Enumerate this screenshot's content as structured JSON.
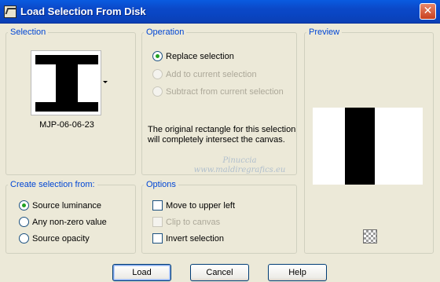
{
  "window": {
    "title": "Load Selection From Disk",
    "close_glyph": "✕",
    "app_icon": "selection-tool-icon"
  },
  "selection_group": {
    "title": "Selection",
    "selected_name": "MJP-06-06-23"
  },
  "operation_group": {
    "title": "Operation",
    "options": [
      {
        "label": "Replace selection",
        "checked": true,
        "enabled": true
      },
      {
        "label": "Add to current selection",
        "checked": false,
        "enabled": false
      },
      {
        "label": "Subtract from current selection",
        "checked": false,
        "enabled": false
      }
    ],
    "info_text": "The original rectangle for this selection will completely intersect the canvas."
  },
  "preview_group": {
    "title": "Preview",
    "background_icon": "checkerboard-icon"
  },
  "create_group": {
    "title": "Create selection from:",
    "options": [
      {
        "label": "Source luminance",
        "checked": true
      },
      {
        "label": "Any non-zero value",
        "checked": false
      },
      {
        "label": "Source opacity",
        "checked": false
      }
    ]
  },
  "options_group": {
    "title": "Options",
    "items": [
      {
        "label": "Move to upper left",
        "checked": false,
        "enabled": true
      },
      {
        "label": "Clip to canvas",
        "checked": false,
        "enabled": false
      },
      {
        "label": "Invert selection",
        "checked": false,
        "enabled": true
      }
    ]
  },
  "buttons": {
    "load": "Load",
    "cancel": "Cancel",
    "help": "Help"
  },
  "watermark": {
    "line1": "Pinuccia",
    "line2": "www.maldiregrafics.eu"
  },
  "colors": {
    "titlebar": "#0a4fd8",
    "group_title": "#0046d5",
    "radio_dot": "#21a121",
    "dialog_bg": "#ece9d8"
  }
}
